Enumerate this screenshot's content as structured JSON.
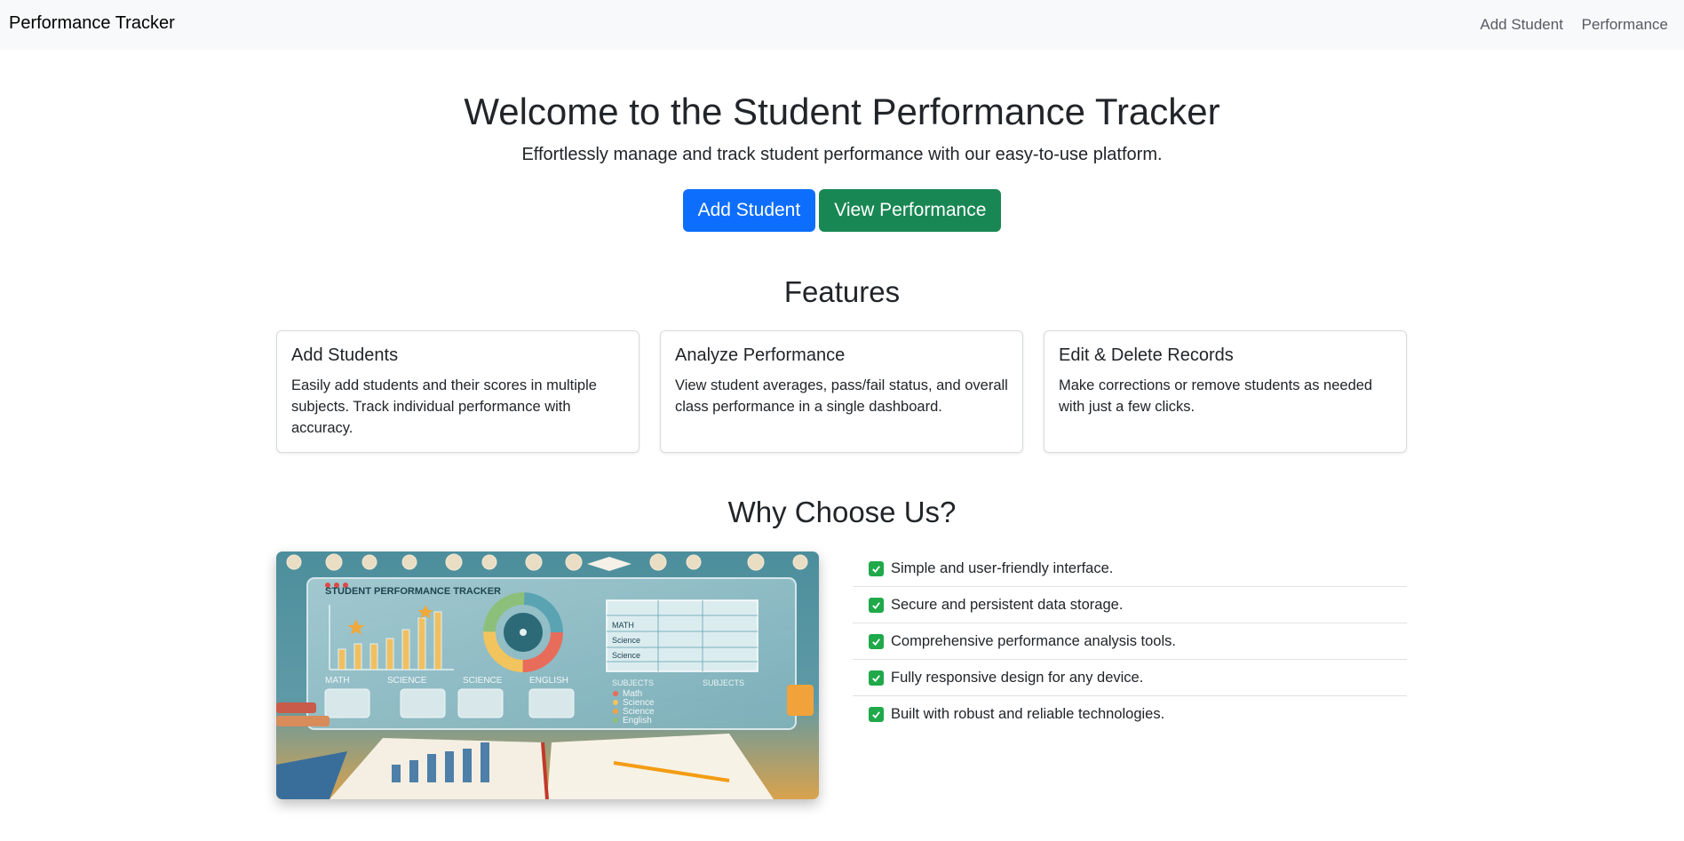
{
  "nav": {
    "brand": "Performance Tracker",
    "links": [
      "Add Student",
      "Performance"
    ]
  },
  "hero": {
    "title": "Welcome to the Student Performance Tracker",
    "subtitle": "Effortlessly manage and track student performance with our easy-to-use platform.",
    "primary_button": "Add Student",
    "secondary_button": "View Performance"
  },
  "features": {
    "title": "Features",
    "cards": [
      {
        "title": "Add Students",
        "text": "Easily add students and their scores in multiple subjects. Track individual performance with accuracy."
      },
      {
        "title": "Analyze Performance",
        "text": "View student averages, pass/fail status, and overall class performance in a single dashboard."
      },
      {
        "title": "Edit & Delete Records",
        "text": "Make corrections or remove students as needed with just a few clicks."
      }
    ]
  },
  "why": {
    "title": "Why Choose Us?",
    "items": [
      "Simple and user-friendly interface.",
      "Secure and persistent data storage.",
      "Comprehensive performance analysis tools.",
      "Fully responsive design for any device.",
      "Built with robust and reliable technologies."
    ],
    "image": {
      "heading": "STUDENT PERFORMANCE TRACKER",
      "subjects": [
        "MATH",
        "SCIENCE",
        "SCIENCE",
        "ENGLISH"
      ],
      "table_labels": [
        "MATH",
        "Science",
        "Science"
      ],
      "legend": [
        "Math",
        "Science",
        "Science",
        "English"
      ],
      "column_labels": [
        "SUBJECTS",
        "SUBJECTS"
      ]
    }
  },
  "colors": {
    "primary": "#0d6efd",
    "success": "#198754",
    "check": "#1fa94a",
    "navbar": "#f8f9fa"
  }
}
